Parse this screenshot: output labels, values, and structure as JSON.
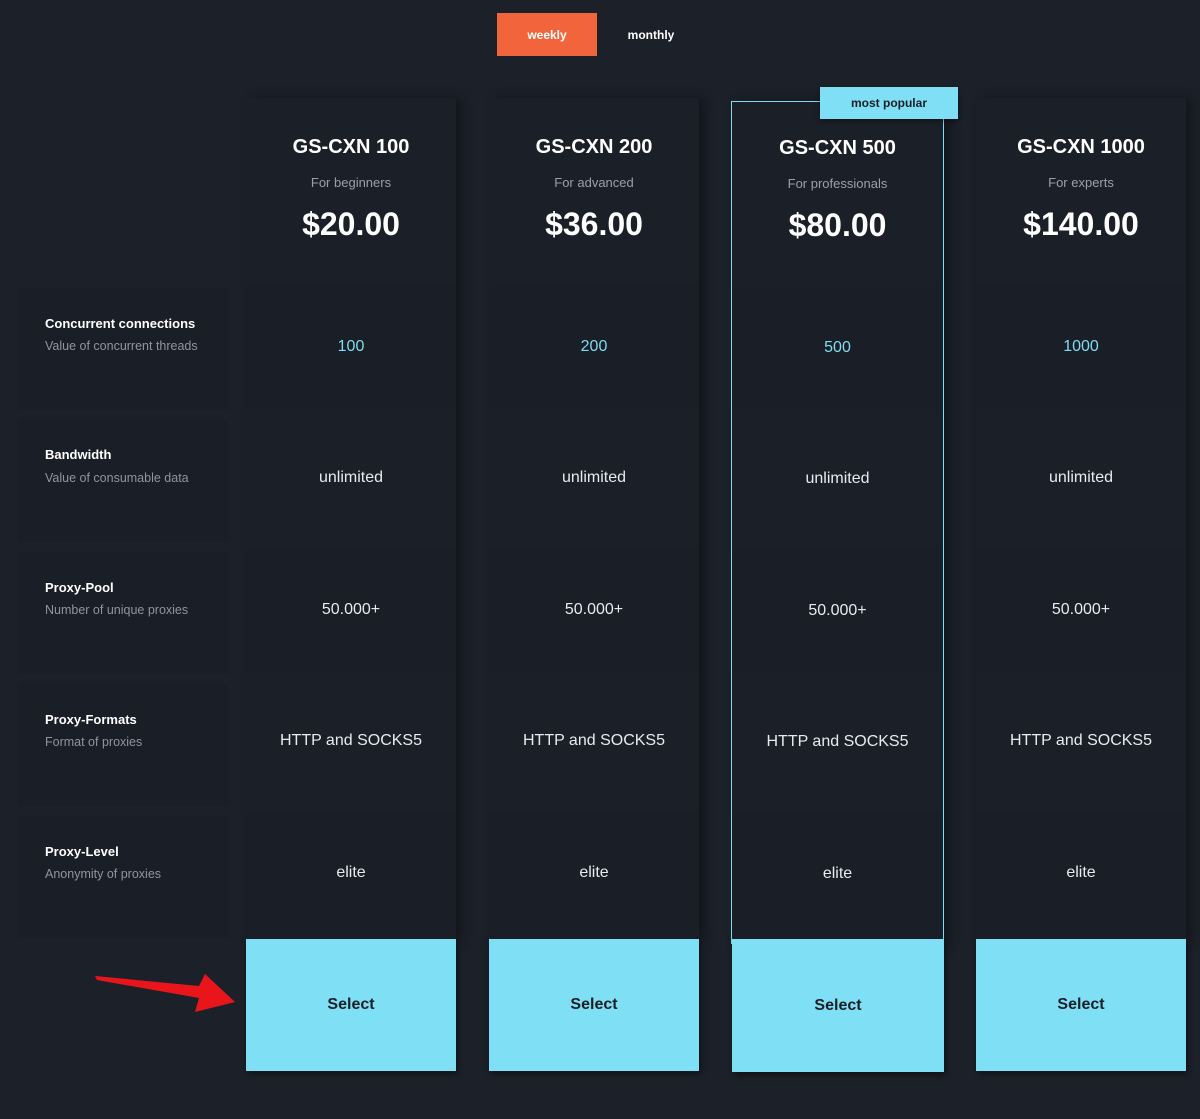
{
  "billing_toggle": {
    "weekly": "weekly",
    "monthly": "monthly"
  },
  "badge": "most popular",
  "features": [
    {
      "title": "Concurrent connections",
      "desc": "Value of concurrent threads"
    },
    {
      "title": "Bandwidth",
      "desc": "Value of consumable data"
    },
    {
      "title": "Proxy-Pool",
      "desc": "Number of unique proxies"
    },
    {
      "title": "Proxy-Formats",
      "desc": "Format of proxies"
    },
    {
      "title": "Proxy-Level",
      "desc": "Anonymity of proxies"
    }
  ],
  "plans": [
    {
      "name": "GS-CXN 100",
      "sub": "For beginners",
      "price": "$20.00",
      "values": [
        "100",
        "unlimited",
        "50.000+",
        "HTTP and SOCKS5",
        "elite"
      ],
      "select": "Select"
    },
    {
      "name": "GS-CXN 200",
      "sub": "For advanced",
      "price": "$36.00",
      "values": [
        "200",
        "unlimited",
        "50.000+",
        "HTTP and SOCKS5",
        "elite"
      ],
      "select": "Select"
    },
    {
      "name": "GS-CXN 500",
      "sub": "For professionals",
      "price": "$80.00",
      "values": [
        "500",
        "unlimited",
        "50.000+",
        "HTTP and SOCKS5",
        "elite"
      ],
      "select": "Select"
    },
    {
      "name": "GS-CXN 1000",
      "sub": "For experts",
      "price": "$140.00",
      "values": [
        "1000",
        "unlimited",
        "50.000+",
        "HTTP and SOCKS5",
        "elite"
      ],
      "select": "Select"
    }
  ],
  "colors": {
    "accent": "#7fdff4",
    "toggle_active": "#f2653c",
    "background": "#1c2029",
    "arrow": "#e8161b"
  }
}
